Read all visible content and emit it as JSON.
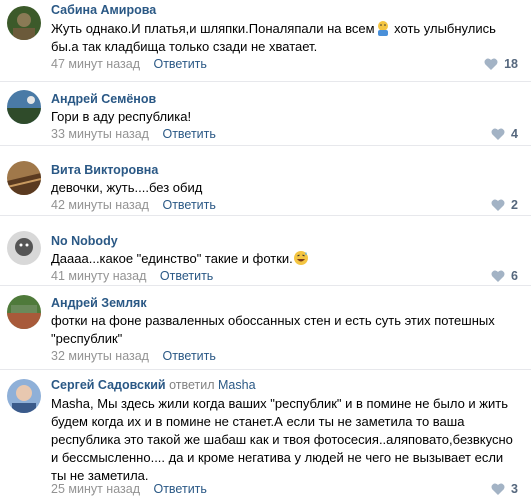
{
  "comments": [
    {
      "author": "Сабина Амирова",
      "text": "Жуть однако.И платья,и шляпки.Поналяпали на всем",
      "text_after_emoji": " хоть улыбнулись бы.а так кладбища только сзади не хватает.",
      "emoji": "person-facepalm-emoji",
      "time": "47 минут назад",
      "reply_label": "Ответить",
      "likes": "18",
      "avatar_colors": [
        "#3c5a2a",
        "#8a7a55"
      ]
    },
    {
      "author": "Андрей Семёнов",
      "text": "Гори в аду республика!",
      "time": "33 минуты назад",
      "reply_label": "Ответить",
      "likes": "4",
      "avatar_colors": [
        "#4a7aa6",
        "#2f4b2a"
      ]
    },
    {
      "author": "Вита Викторовна",
      "text": "девочки, жуть....без обид",
      "time": "42 минуты назад",
      "reply_label": "Ответить",
      "likes": "2",
      "avatar_colors": [
        "#a0784a",
        "#5a3a20"
      ]
    },
    {
      "author": "No Nobody",
      "text": "Даааа...какое \"единство\" такие и фотки.",
      "emoji": "grinning-sweat-emoji",
      "time": "41 минуту назад",
      "reply_label": "Ответить",
      "likes": "6",
      "avatar_colors": [
        "#d8d8d8",
        "#555555"
      ]
    },
    {
      "author": "Андрей Земляк",
      "text": "фотки на фоне разваленных обоссанных стен и есть суть этих потешных \"республик\"",
      "time": "32 минуты назад",
      "reply_label": "Ответить",
      "likes": "",
      "avatar_colors": [
        "#4f7a3a",
        "#a85a3a"
      ]
    },
    {
      "author": "Сергей Садовский",
      "replied_label": "ответил",
      "replied_to": "Masha",
      "text": "Masha, Мы здесь жили когда ваших \"республик\" и в помине не было и жить будем когда их и в помине не станет.А если ты не заметила то ваша республика это такой же шабаш как и твоя фотосесия..аляповато,безвкусно и бессмысленно.... да и кроме негатива у людей не чего не вызывает если ты не заметила.",
      "time": "25 минут назад",
      "reply_label": "Ответить",
      "likes": "3",
      "avatar_colors": [
        "#8fb0d8",
        "#e8c8b0"
      ]
    }
  ],
  "colors": {
    "link": "#2a5885",
    "meta": "#939393",
    "likes": "#55677d",
    "heart": "#a3b3c5",
    "divider": "#e7e8ec"
  }
}
